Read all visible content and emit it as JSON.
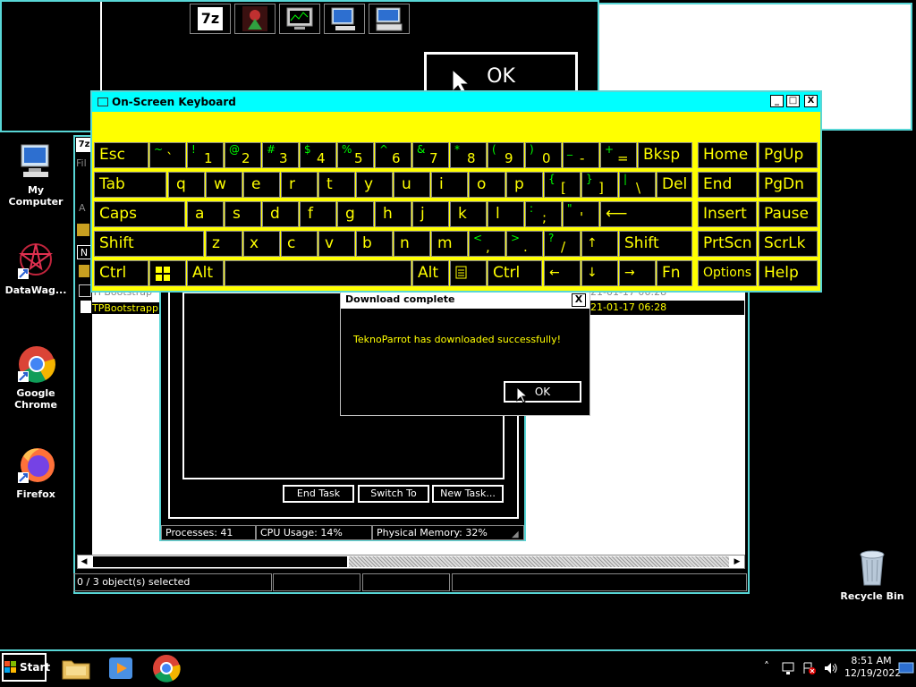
{
  "desktop_icons": [
    {
      "label": "My Computer",
      "icon": "my-computer-icon"
    },
    {
      "label": "DataWag...",
      "icon": "datawag-icon"
    },
    {
      "label": "Google Chrome",
      "icon": "chrome-icon"
    },
    {
      "label": "Firefox",
      "icon": "firefox-icon"
    },
    {
      "label": "Recycle Bin",
      "icon": "recycle-bin-icon"
    }
  ],
  "background_dialog": {
    "ok_label": "OK"
  },
  "zip": {
    "menu_first": "Fil",
    "toolbar_fragment": "A",
    "col_first": "N",
    "rows": [
      {
        "name": "TPBootstrap",
        "date": "21-01-17 06:28"
      },
      {
        "name": "TPBootstrapp",
        "date": "21-01-17 06:28"
      }
    ],
    "status": "0 / 3 object(s) selected"
  },
  "taskmgr": {
    "end_task": "End Task",
    "switch_to": "Switch To",
    "new_task": "New Task...",
    "processes": "Processes: 41",
    "cpu": "CPU Usage: 14%",
    "memory": "Physical Memory: 32%"
  },
  "dialog": {
    "title": "Download complete",
    "message": "TeknoParrot has downloaded successfully!",
    "ok_label": "OK",
    "close": "X"
  },
  "osk": {
    "title": "On-Screen Keyboard",
    "rows": [
      [
        {
          "s": "~",
          "m": "`"
        },
        {
          "s": "!",
          "m": "1"
        },
        {
          "s": "@",
          "m": "2"
        },
        {
          "s": "#",
          "m": "3"
        },
        {
          "s": "$",
          "m": "4"
        },
        {
          "s": "%",
          "m": "5"
        },
        {
          "s": "^",
          "m": "6"
        },
        {
          "s": "&",
          "m": "7"
        },
        {
          "s": "*",
          "m": "8"
        },
        {
          "s": "(",
          "m": "9"
        },
        {
          "s": ")",
          "m": "0"
        },
        {
          "s": "_",
          "m": "-"
        },
        {
          "s": "+",
          "m": "="
        }
      ],
      [
        "q",
        "w",
        "e",
        "r",
        "t",
        "y",
        "u",
        "i",
        "o",
        "p"
      ],
      [
        "a",
        "s",
        "d",
        "f",
        "g",
        "h",
        "j",
        "k",
        "l"
      ],
      [
        "z",
        "x",
        "c",
        "v",
        "b",
        "n",
        "m"
      ]
    ],
    "brackets": [
      {
        "s": "{",
        "m": "["
      },
      {
        "s": "}",
        "m": "]"
      },
      {
        "s": "|",
        "m": "\\"
      }
    ],
    "semis": [
      {
        "s": ":",
        "m": ";"
      },
      {
        "s": "\"",
        "m": "'"
      }
    ],
    "commas": [
      {
        "s": "<",
        "m": ","
      },
      {
        "s": ">",
        "m": "."
      },
      {
        "s": "?",
        "m": "/"
      }
    ],
    "esc": "Esc",
    "bksp": "Bksp",
    "home": "Home",
    "pgup": "PgUp",
    "tab": "Tab",
    "del": "Del",
    "end": "End",
    "pgdn": "PgDn",
    "caps": "Caps",
    "insert": "Insert",
    "pause": "Pause",
    "shift": "Shift",
    "prtscn": "PrtScn",
    "scrlk": "ScrLk",
    "ctrl": "Ctrl",
    "alt": "Alt",
    "fn": "Fn",
    "options": "Options",
    "help": "Help",
    "up": "↑",
    "left": "←",
    "down": "↓",
    "right": "→",
    "enter": "⟵"
  },
  "taskbar": {
    "start": "Start",
    "time": "8:51 AM",
    "date": "12/19/2022"
  }
}
